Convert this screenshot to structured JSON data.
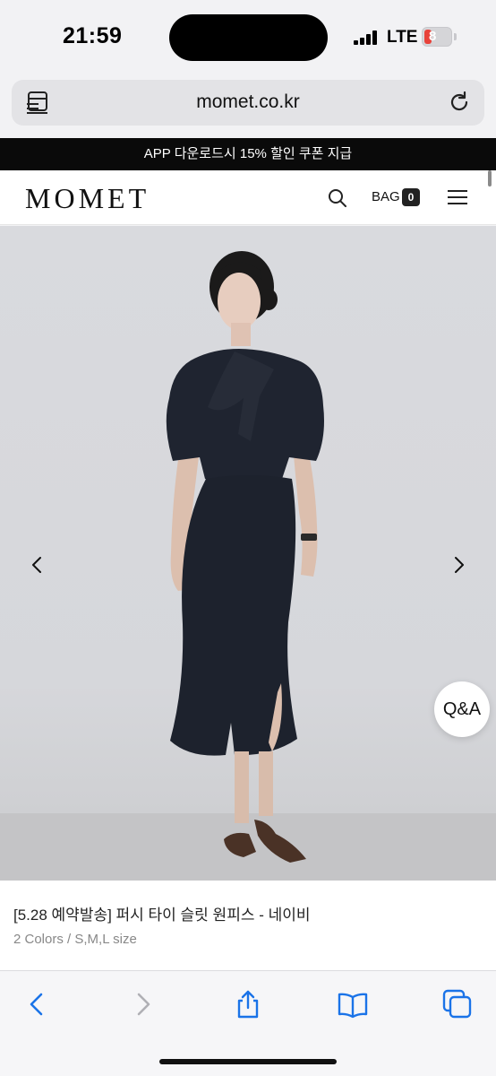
{
  "status_bar": {
    "time": "21:59",
    "network": "LTE",
    "battery": "8"
  },
  "browser": {
    "url": "momet.co.kr"
  },
  "promo": {
    "text": "APP 다운로드시 15% 할인 쿠폰 지급"
  },
  "header": {
    "logo": "MOMET",
    "bag_label": "BAG",
    "bag_count": "0"
  },
  "hero": {
    "qa_label": "Q&A"
  },
  "product": {
    "name": "[5.28 예약발송] 퍼시 타이 슬릿 원피스 - 네이비",
    "meta": "2 Colors / S,M,L size"
  },
  "colors": {
    "accent": "#1a73e8",
    "banner": "#0a0a0a",
    "battery_low": "#e8423a"
  }
}
